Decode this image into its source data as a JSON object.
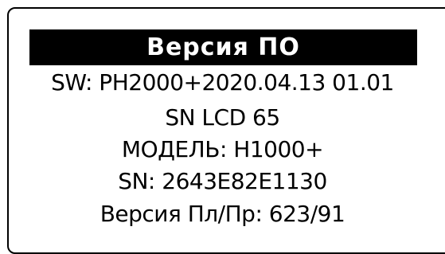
{
  "title": "Версия ПО",
  "info": {
    "sw": "SW: PH2000+2020.04.13 01.01",
    "sn_lcd": "SN LCD 65",
    "model": "МОДЕЛЬ: H1000+",
    "sn": "SN: 2643E82E1130",
    "version_pl_pr": "Версия Пл/Пр: 623/91"
  },
  "colors": {
    "background": "#ffffff",
    "title_bar": "#000000",
    "title_text": "#ffffff",
    "text": "#000000"
  }
}
